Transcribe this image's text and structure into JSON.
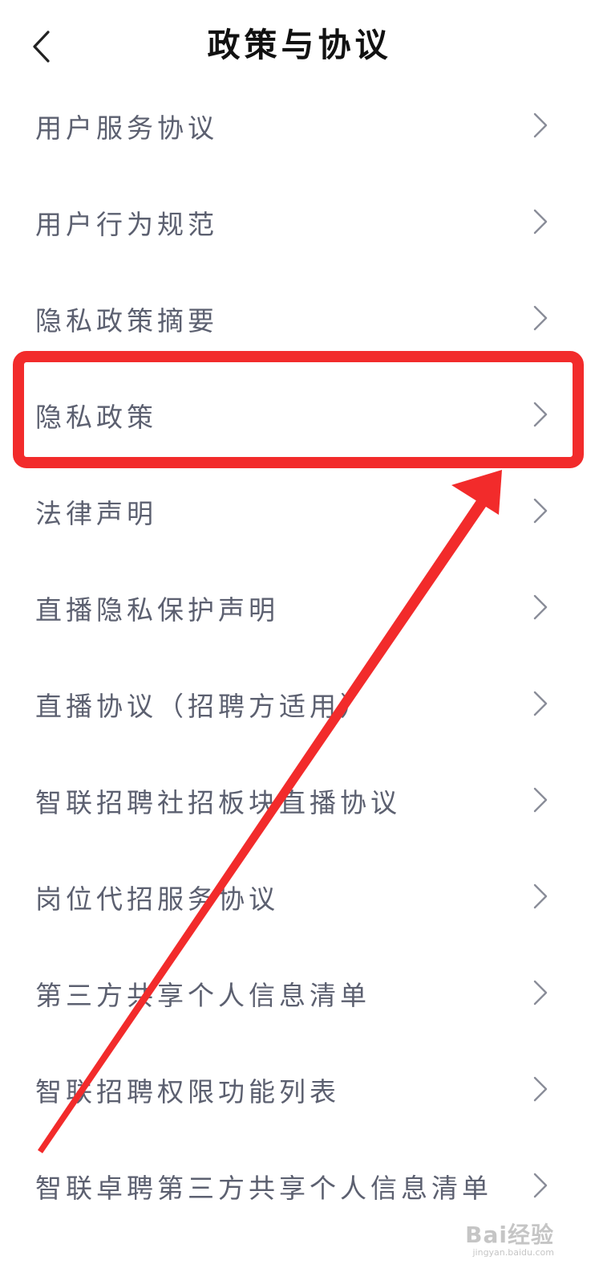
{
  "header": {
    "title": "政策与协议",
    "back_icon": "chevron-left-icon"
  },
  "list": {
    "chevron_icon": "chevron-right-icon",
    "items": [
      {
        "label": "用户服务协议"
      },
      {
        "label": "用户行为规范"
      },
      {
        "label": "隐私政策摘要"
      },
      {
        "label": "隐私政策"
      },
      {
        "label": "法律声明"
      },
      {
        "label": "直播隐私保护声明"
      },
      {
        "label": "直播协议（招聘方适用）"
      },
      {
        "label": "智联招聘社招板块直播协议"
      },
      {
        "label": "岗位代招服务协议"
      },
      {
        "label": "第三方共享个人信息清单"
      },
      {
        "label": "智联招聘权限功能列表"
      },
      {
        "label": "智联卓聘第三方共享个人信息清单"
      }
    ]
  },
  "annotation": {
    "highlighted_item": "隐私政策",
    "color": "#f22b2b"
  },
  "watermark": {
    "main": "Bai经验",
    "sub": "jingyan.baidu.com"
  },
  "colors": {
    "title": "#111111",
    "item_text": "#5c6070",
    "chevron": "#8a8d99",
    "background": "#ffffff"
  }
}
